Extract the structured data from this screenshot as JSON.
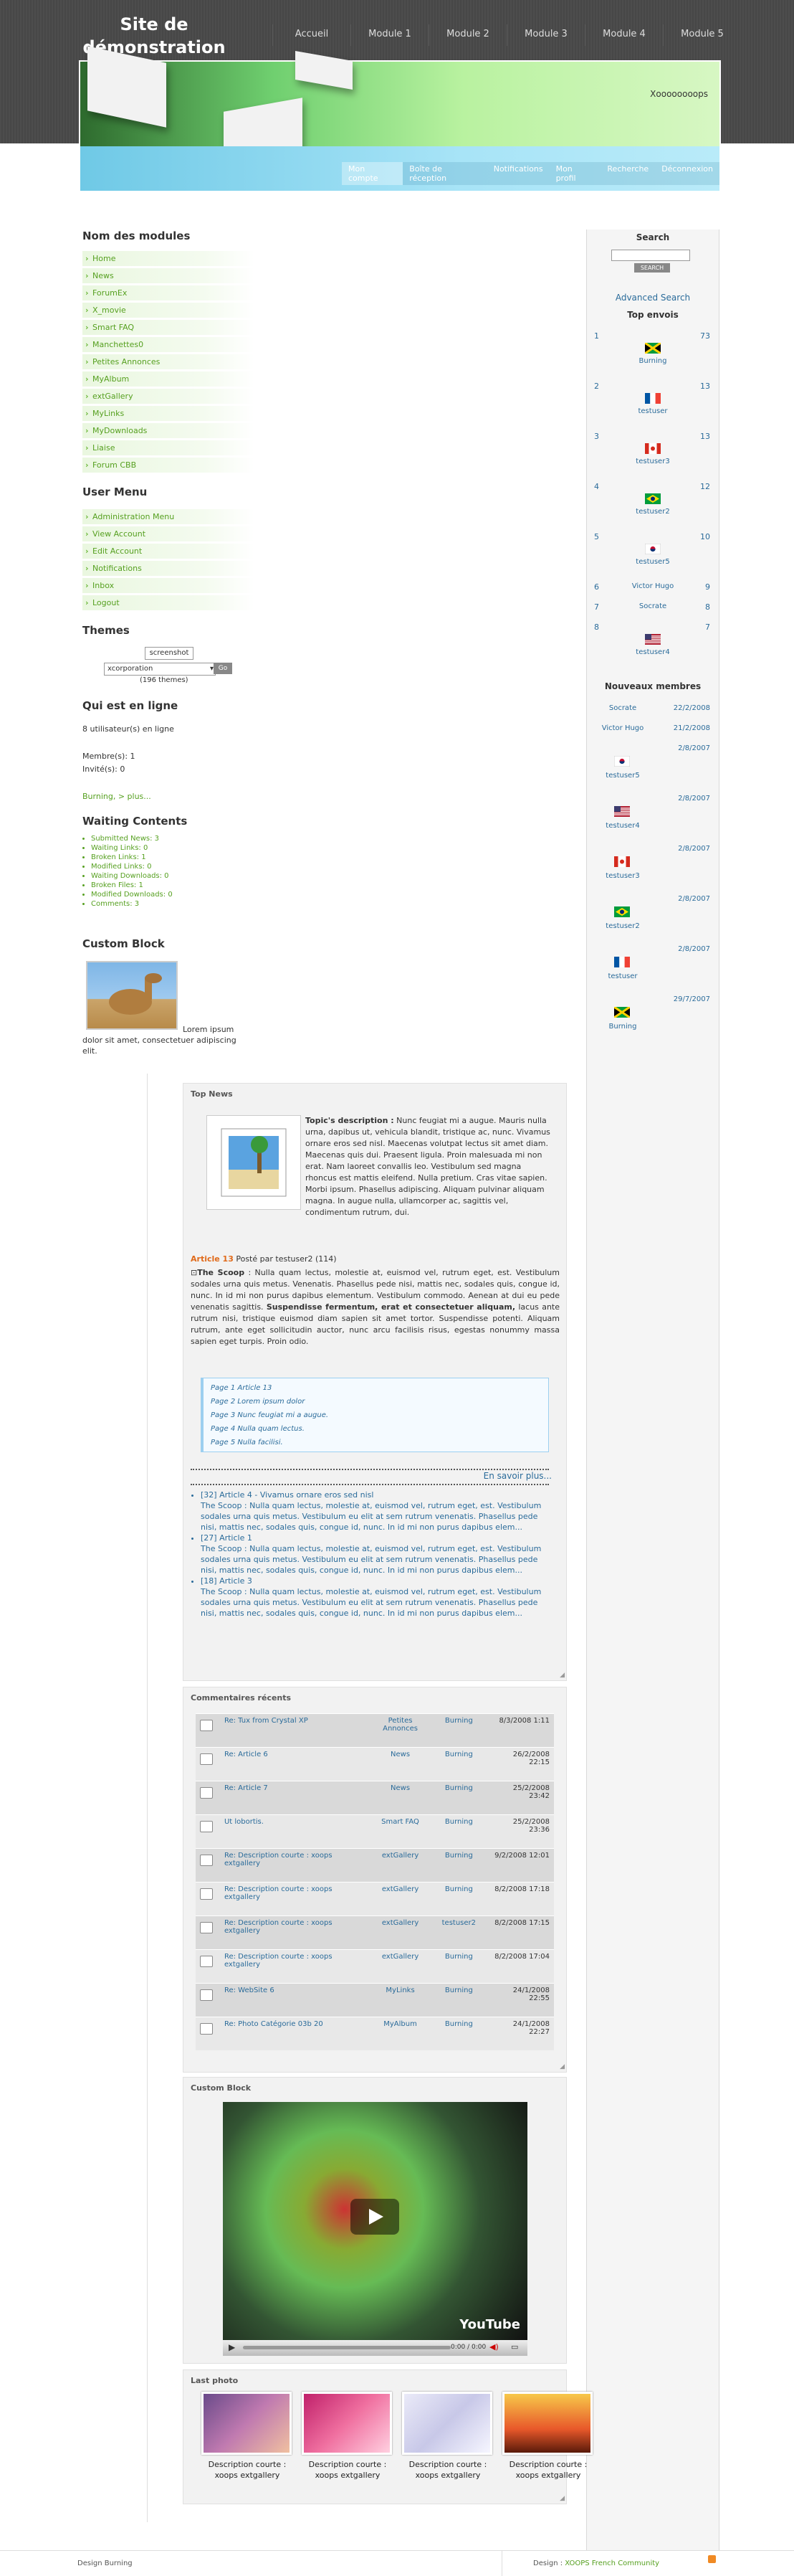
{
  "header": {
    "site_title": "Site de démonstration",
    "nav": [
      "Accueil",
      "Module 1",
      "Module 2",
      "Module 3",
      "Module 4",
      "Module 5"
    ],
    "slogan": "Xoooooooops",
    "user_nav": [
      "Mon compte",
      "Boîte de réception",
      "Notifications",
      "Mon profil",
      "Recherche",
      "Déconnexion"
    ]
  },
  "modules": {
    "title": "Nom des modules",
    "items": [
      "Home",
      "News",
      "ForumEx",
      "X_movie",
      "Smart FAQ",
      "Manchettes0",
      "Petites Annonces",
      "MyAlbum",
      "extGallery",
      "MyLinks",
      "MyDownloads",
      "Liaise",
      "Forum CBB"
    ]
  },
  "user_menu": {
    "title": "User Menu",
    "items": [
      "Administration Menu",
      "View Account",
      "Edit Account",
      "Notifications",
      "Inbox",
      "Logout"
    ]
  },
  "themes": {
    "title": "Themes",
    "preview_alt": "screenshot",
    "selected": "xcorporation",
    "go_label": "Go",
    "count_text": "(196 themes)"
  },
  "online": {
    "title": "Qui est en ligne",
    "users_online": "8 utilisateur(s) en ligne",
    "members": "Membre(s): 1",
    "guests": "Invité(s): 0",
    "list": "Burning, > plus..."
  },
  "waiting": {
    "title": "Waiting Contents",
    "items": [
      "Submitted News: 3",
      "Waiting Links: 0",
      "Broken Links: 1",
      "Modified Links: 0",
      "Waiting Downloads: 0",
      "Broken Files: 1",
      "Modified Downloads: 0",
      "Comments: 3"
    ]
  },
  "custom_block_left": {
    "title": "Custom Block",
    "text": "Lorem ipsum dolor sit amet, consectetuer adipiscing elit."
  },
  "search": {
    "title": "Search",
    "button": "SEARCH",
    "advanced": "Advanced Search"
  },
  "top_posters": {
    "title": "Top envois",
    "rows": [
      {
        "rank": "1",
        "name": "Burning",
        "count": "73",
        "flag": "jamaica"
      },
      {
        "rank": "2",
        "name": "testuser",
        "count": "13",
        "flag": "france"
      },
      {
        "rank": "3",
        "name": "testuser3",
        "count": "13",
        "flag": "canada"
      },
      {
        "rank": "4",
        "name": "testuser2",
        "count": "12",
        "flag": "brazil"
      },
      {
        "rank": "5",
        "name": "testuser5",
        "count": "10",
        "flag": "korea"
      },
      {
        "rank": "6",
        "name": "Victor Hugo",
        "count": "9",
        "flag": ""
      },
      {
        "rank": "7",
        "name": "Socrate",
        "count": "8",
        "flag": ""
      },
      {
        "rank": "8",
        "name": "testuser4",
        "count": "7",
        "flag": "usa"
      }
    ]
  },
  "new_members": {
    "title": "Nouveaux membres",
    "rows": [
      {
        "name": "Socrate",
        "date": "22/2/2008",
        "flag": ""
      },
      {
        "name": "Victor Hugo",
        "date": "21/2/2008",
        "flag": ""
      },
      {
        "name": "testuser5",
        "date": "2/8/2007",
        "flag": "korea"
      },
      {
        "name": "testuser4",
        "date": "2/8/2007",
        "flag": "usa"
      },
      {
        "name": "testuser3",
        "date": "2/8/2007",
        "flag": "canada"
      },
      {
        "name": "testuser2",
        "date": "2/8/2007",
        "flag": "brazil"
      },
      {
        "name": "testuser",
        "date": "2/8/2007",
        "flag": "france"
      },
      {
        "name": "Burning",
        "date": "29/7/2007",
        "flag": "jamaica"
      }
    ]
  },
  "top_news": {
    "title": "Top News",
    "topic_label": "Topic's description :",
    "topic_text": "Nunc feugiat mi a augue. Mauris nulla urna, dapibus ut, vehicula blandit, tristique ac, nunc. Vivamus ornare eros sed nisl. Maecenas volutpat lectus sit amet diam. Maecenas quis dui. Praesent ligula. Proin malesuada mi non erat. Nam laoreet convallis leo. Vestibulum sed magna rhoncus est mattis eleifend. Nulla pretium. Cras vitae sapien. Morbi ipsum. Phasellus adipiscing. Aliquam pulvinar aliquam magna. In augue nulla, ullamcorper ac, sagittis vel, condimentum rutrum, dui.",
    "article_title": "Article 13",
    "article_meta": "Posté par testuser2 (114)",
    "scoop_label": "The Scoop",
    "scoop_text_1": " : Nulla quam lectus, molestie at, euismod vel, rutrum eget, est. Vestibulum sodales urna quis metus. Venenatis. Phasellus pede nisi, mattis nec, sodales quis, congue id, nunc. In id mi non purus dapibus elementum. Vestibulum commodo. Aenean at dui eu pede venenatis sagittis.",
    "scoop_bold": "Suspendisse fermentum, erat et consectetuer aliquam,",
    "scoop_text_2": " lacus ante rutrum nisi, tristique euismod diam sapien sit amet tortor. Suspendisse potenti. Aliquam rutrum, ante eget sollicitudin auctor, nunc arcu facilisis risus, egestas nonummy massa sapien eget turpis. Proin odio.",
    "pages": [
      "Page 1 Article 13",
      "Page 2 Lorem ipsum dolor",
      "Page 3 Nunc feugiat mi a augue.",
      "Page 4 Nulla quam lectus.",
      "Page 5 Nulla facilisi."
    ],
    "more": "En savoir plus...",
    "others": [
      {
        "title": "[32] Article 4 - Vivamus ornare eros sed nisl",
        "text": "The Scoop : Nulla quam lectus, molestie at, euismod vel, rutrum eget, est. Vestibulum sodales urna quis metus. Vestibulum eu elit at sem rutrum venenatis. Phasellus pede nisi, mattis nec, sodales quis, congue id, nunc. In id mi non purus dapibus elem..."
      },
      {
        "title": "[27] Article 1",
        "text": "The Scoop : Nulla quam lectus, molestie at, euismod vel, rutrum eget, est. Vestibulum sodales urna quis metus. Vestibulum eu elit at sem rutrum venenatis. Phasellus pede nisi, mattis nec, sodales quis, congue id, nunc. In id mi non purus dapibus elem..."
      },
      {
        "title": "[18] Article 3",
        "text": "The Scoop : Nulla quam lectus, molestie at, euismod vel, rutrum eget, est. Vestibulum sodales urna quis metus. Vestibulum eu elit at sem rutrum venenatis. Phasellus pede nisi, mattis nec, sodales quis, congue id, nunc. In id mi non purus dapibus elem..."
      }
    ]
  },
  "comments": {
    "title": "Commentaires récents",
    "rows": [
      {
        "subject": "Re: Tux from Crystal XP",
        "module": "Petites Annonces",
        "user": "Burning",
        "date": "8/3/2008 1:11"
      },
      {
        "subject": "Re: Article 6",
        "module": "News",
        "user": "Burning",
        "date": "26/2/2008 22:15"
      },
      {
        "subject": "Re: Article 7",
        "module": "News",
        "user": "Burning",
        "date": "25/2/2008 23:42"
      },
      {
        "subject": "Ut lobortis.",
        "module": "Smart FAQ",
        "user": "Burning",
        "date": "25/2/2008 23:36"
      },
      {
        "subject": "Re: Description courte : xoops extgallery",
        "module": "extGallery",
        "user": "Burning",
        "date": "9/2/2008 12:01"
      },
      {
        "subject": "Re: Description courte : xoops extgallery",
        "module": "extGallery",
        "user": "Burning",
        "date": "8/2/2008 17:18"
      },
      {
        "subject": "Re: Description courte : xoops extgallery",
        "module": "extGallery",
        "user": "testuser2",
        "date": "8/2/2008 17:15"
      },
      {
        "subject": "Re: Description courte : xoops extgallery",
        "module": "extGallery",
        "user": "Burning",
        "date": "8/2/2008 17:04"
      },
      {
        "subject": "Re: WebSite 6",
        "module": "MyLinks",
        "user": "Burning",
        "date": "24/1/2008 22:55"
      },
      {
        "subject": "Re: Photo Catégorie 03b 20",
        "module": "MyAlbum",
        "user": "Burning",
        "date": "24/1/2008 22:27"
      }
    ]
  },
  "custom_block_video": {
    "title": "Custom Block",
    "time": "0:00 / 0:00",
    "brand": "YouTube"
  },
  "last_photo": {
    "title": "Last photo",
    "captions": [
      "Description courte : xoops extgallery",
      "Description courte : xoops extgallery",
      "Description courte : xoops extgallery",
      "Description courte : xoops extgallery"
    ]
  },
  "footer": {
    "left": "Design Burning",
    "right_prefix": "Design :",
    "right_link": "XOOPS French Community"
  }
}
